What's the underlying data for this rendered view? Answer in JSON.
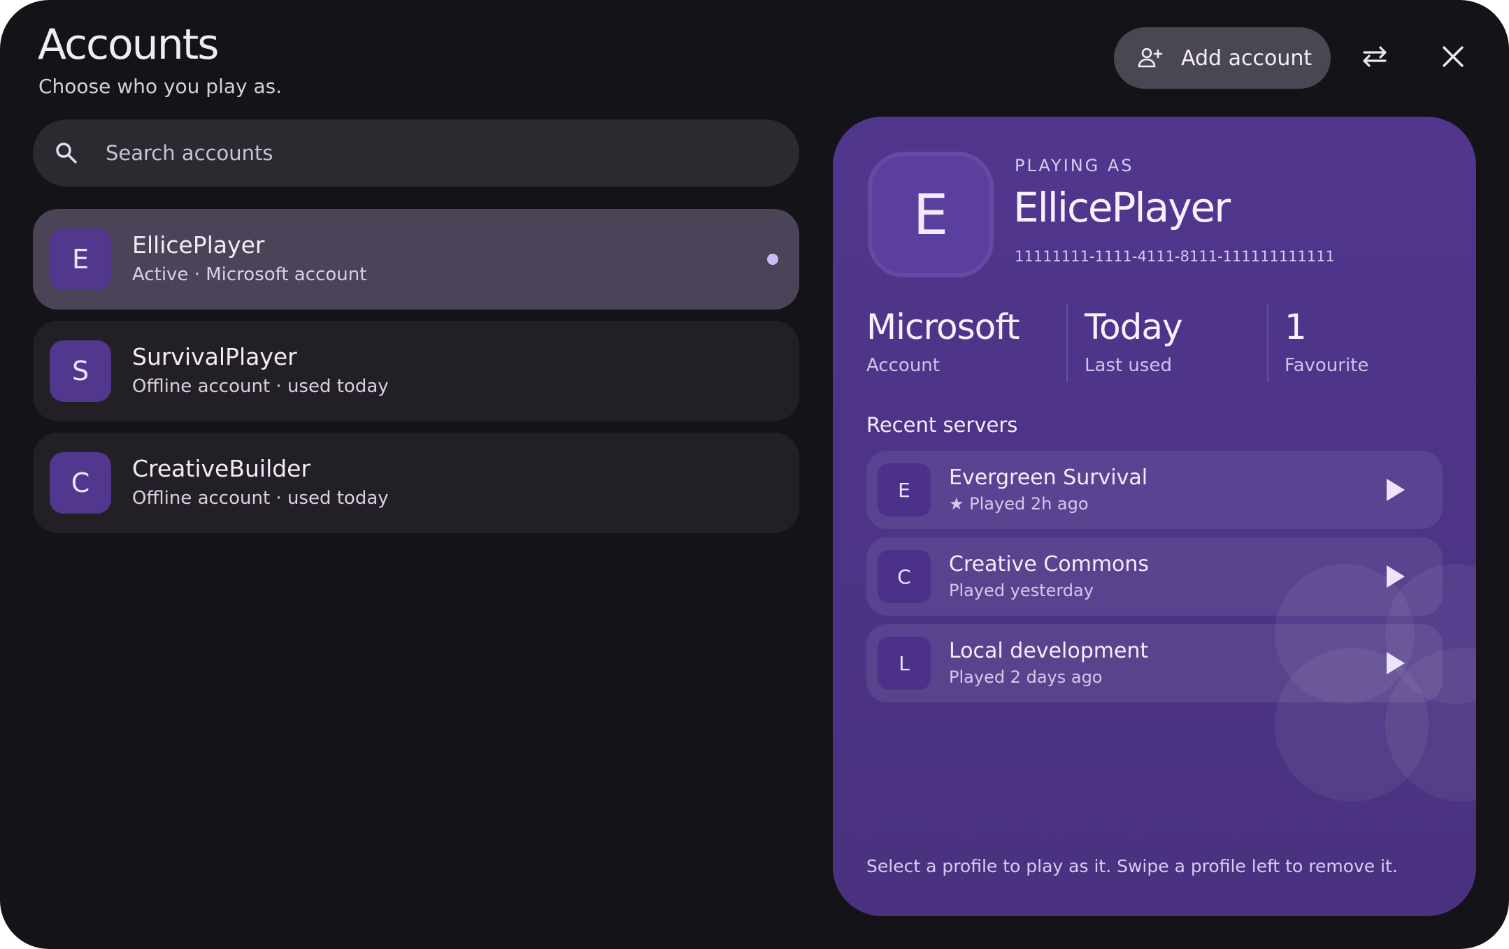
{
  "header": {
    "title": "Accounts",
    "subtitle": "Choose who you play as.",
    "add_account_label": "Add account"
  },
  "search": {
    "placeholder": "Search accounts"
  },
  "accounts": [
    {
      "initial": "E",
      "name": "EllicePlayer",
      "meta": "Active · Microsoft account",
      "active": true
    },
    {
      "initial": "S",
      "name": "SurvivalPlayer",
      "meta": "Offline account · used today",
      "active": false
    },
    {
      "initial": "C",
      "name": "CreativeBuilder",
      "meta": "Offline account · used today",
      "active": false
    }
  ],
  "panel": {
    "initial": "E",
    "playing_as_label": "PLAYING AS",
    "name": "EllicePlayer",
    "uuid": "11111111-1111-4111-8111-111111111111",
    "stats": [
      {
        "value": "Microsoft",
        "label": "Account"
      },
      {
        "value": "Today",
        "label": "Last used"
      },
      {
        "value": "1",
        "label": "Favourite"
      }
    ],
    "recent_servers_title": "Recent servers",
    "servers": [
      {
        "initial": "E",
        "name": "Evergreen Survival",
        "meta": "★ Played 2h ago"
      },
      {
        "initial": "C",
        "name": "Creative Commons",
        "meta": "Played yesterday"
      },
      {
        "initial": "L",
        "name": "Local development",
        "meta": "Played 2 days ago"
      }
    ],
    "hint": "Select a profile to play as it. Swipe a profile left to remove it."
  },
  "icons": {
    "add_account": "person-add-icon",
    "swap": "swap-arrows-icon",
    "close": "close-icon",
    "search": "search-icon",
    "play": "play-icon"
  },
  "colors": {
    "window_bg": "#141318",
    "panel_bg": "#50368d",
    "avatar": "#52378f",
    "active_row": "#4b4458",
    "active_dot": "#cdbbf7"
  }
}
